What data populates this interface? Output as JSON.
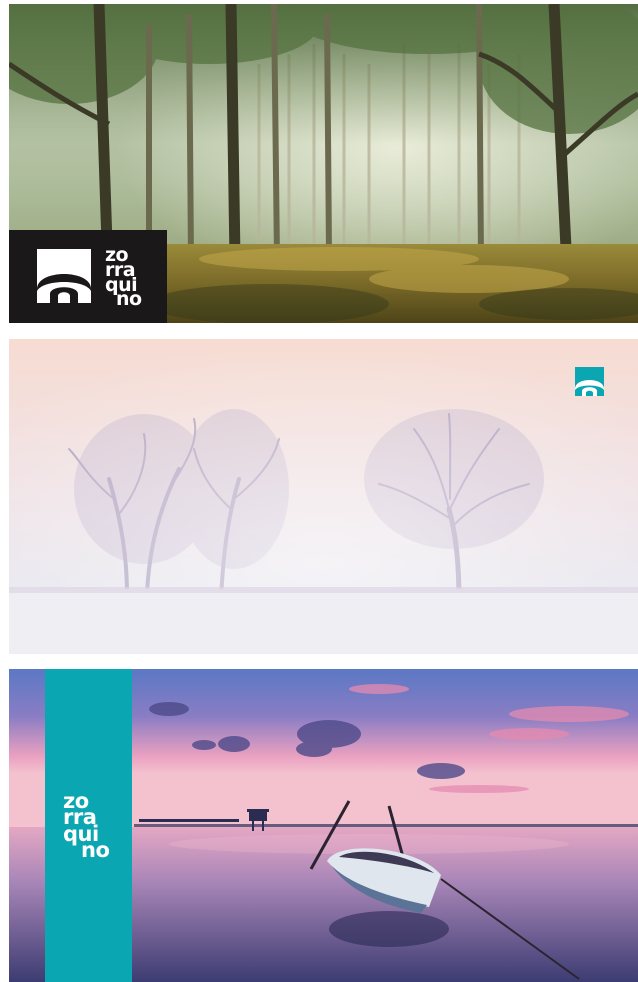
{
  "brand": {
    "wordmark_lines": [
      "zo",
      "rra",
      "qui",
      "no"
    ],
    "logo_icon": "arch-square-icon",
    "colors": {
      "logo_dark_bg": "#1a1818",
      "teal": "#0aa6b2",
      "white": "#ffffff"
    }
  },
  "panels": [
    {
      "name": "forest",
      "scene": "sunlit misty forest"
    },
    {
      "name": "fog",
      "scene": "two bare trees in pink fog"
    },
    {
      "name": "sunset",
      "scene": "rowboat on lake at purple sunset"
    }
  ]
}
